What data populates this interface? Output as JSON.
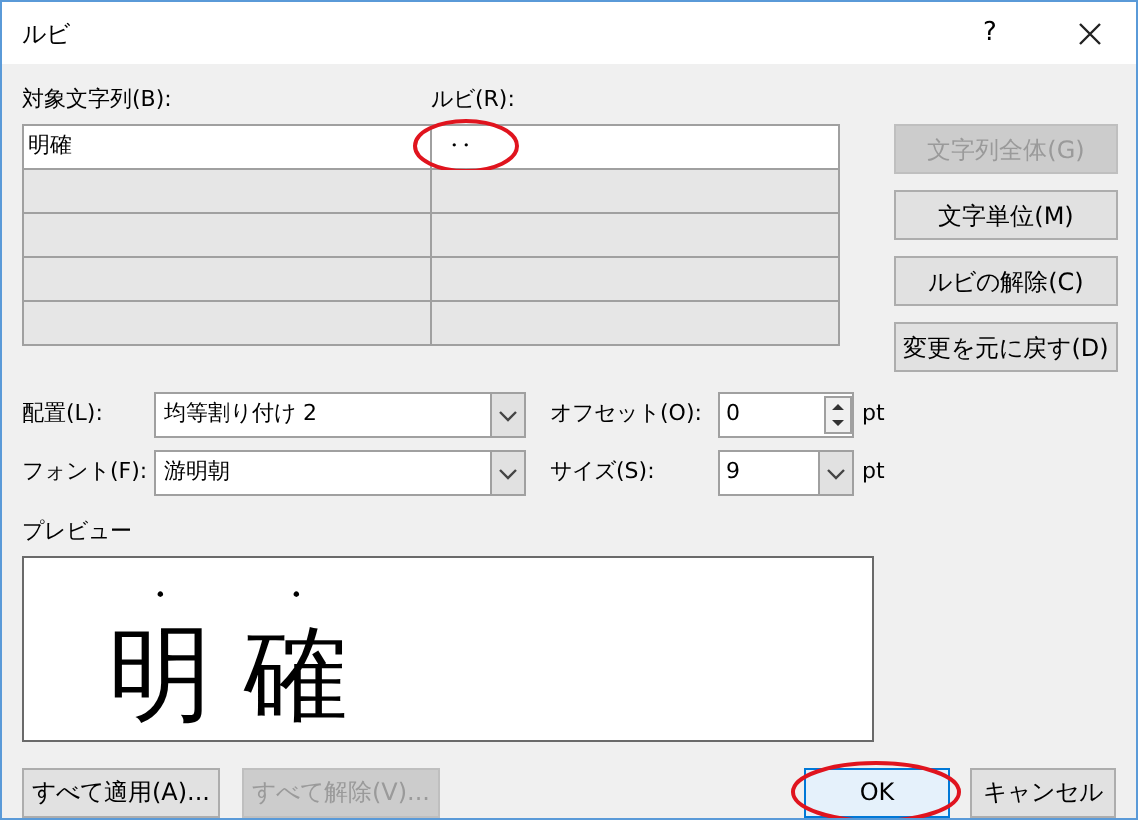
{
  "window": {
    "title": "ルビ",
    "help": "?"
  },
  "table": {
    "columns": [
      "対象文字列(B):",
      "ルビ(R):"
    ],
    "rows": [
      {
        "base": "明確",
        "ruby": "・・",
        "highlighted": true
      },
      {
        "base": "",
        "ruby": ""
      },
      {
        "base": "",
        "ruby": ""
      },
      {
        "base": "",
        "ruby": ""
      },
      {
        "base": "",
        "ruby": ""
      }
    ]
  },
  "side_buttons": [
    {
      "label": "文字列全体(G)",
      "disabled": true
    },
    {
      "label": "文字単位(M)",
      "disabled": false
    },
    {
      "label": "ルビの解除(C)",
      "disabled": false
    },
    {
      "label": "変更を元に戻す(D)",
      "disabled": false
    }
  ],
  "fields": [
    {
      "label": "配置(L):",
      "value": "均等割り付け 2"
    },
    {
      "label": "フォント(F):",
      "value": "游明朝"
    }
  ],
  "spin_fields": [
    {
      "label": "オフセット(O):",
      "value": "0",
      "unit": "pt",
      "kind": "spinner"
    },
    {
      "label": "サイズ(S):",
      "value": "9",
      "unit": "pt",
      "kind": "combo"
    }
  ],
  "preview": {
    "label": "プレビュー",
    "chars": [
      {
        "base": "明",
        "ruby": "・"
      },
      {
        "base": "確",
        "ruby": "・"
      }
    ]
  },
  "bottom_buttons": [
    {
      "label": "すべて適用(A)...",
      "disabled": false
    },
    {
      "label": "すべて解除(V)...",
      "disabled": true
    }
  ],
  "dialog_buttons": [
    {
      "label": "OK",
      "default": true,
      "highlighted": true
    },
    {
      "label": "キャンセル",
      "default": false,
      "highlighted": false
    }
  ]
}
